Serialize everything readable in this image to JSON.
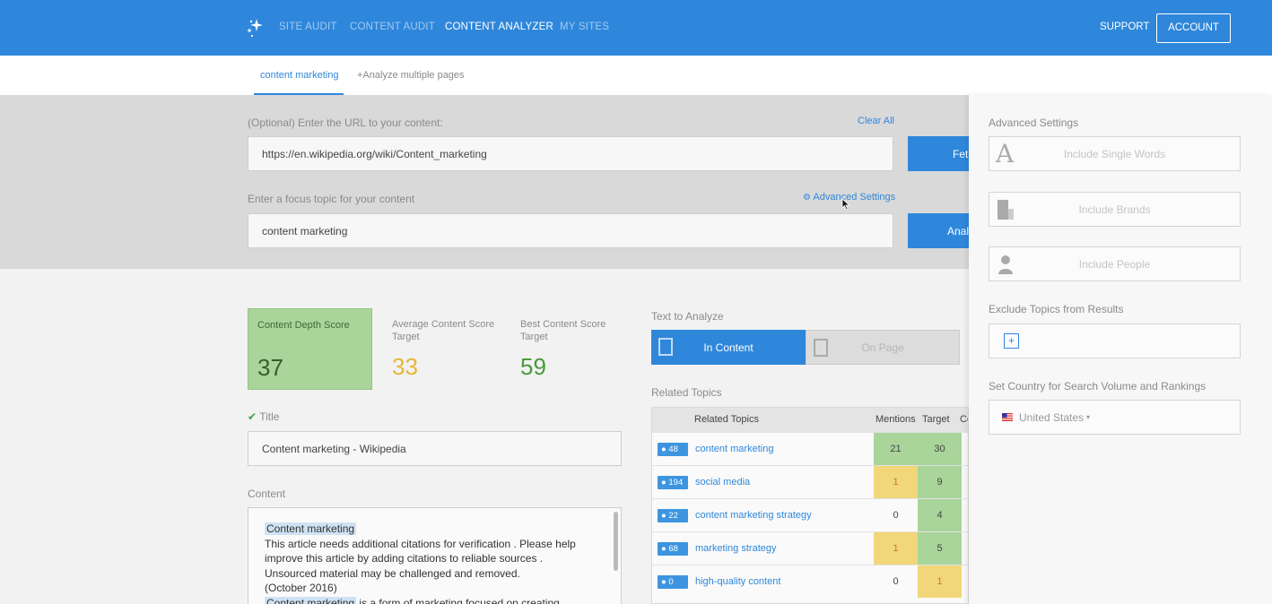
{
  "nav": {
    "items": [
      "SITE AUDIT",
      "CONTENT AUDIT",
      "CONTENT ANALYZER",
      "MY SITES"
    ],
    "active": "CONTENT ANALYZER",
    "support": "SUPPORT",
    "account": "ACCOUNT"
  },
  "subtabs": {
    "current": "content marketing",
    "add": "+Analyze multiple pages"
  },
  "inputs": {
    "url_label": "(Optional) Enter the URL to your content:",
    "clear_all": "Clear All",
    "url_value": "https://en.wikipedia.org/wiki/Content_marketing",
    "fetch_button": "Fetch",
    "focus_label": "Enter a focus topic for your content",
    "advanced_link": "Advanced Settings",
    "focus_value": "content marketing",
    "analyze_button": "Analyze"
  },
  "scores": {
    "depth_label": "Content Depth Score",
    "depth_value": "37",
    "avg_label": "Average Content Score Target",
    "avg_value": "33",
    "best_label": "Best Content Score Target",
    "best_value": "59"
  },
  "title_section": {
    "label": "Title",
    "value": "Content marketing - Wikipedia"
  },
  "content_section": {
    "label": "Content",
    "lines": [
      "Content marketing",
      "This article needs additional citations for verification . Please help",
      "improve this article by adding citations to reliable sources .",
      "Unsourced material may be challenged and removed.",
      "(October 2016)",
      "Content marketing",
      " is a form of marketing focused on creating,"
    ]
  },
  "analyze_toggle": {
    "label": "Text to Analyze",
    "in_content": "In Content",
    "on_page": "On Page"
  },
  "related": {
    "label": "Related Topics",
    "headers": [
      "Related Topics",
      "Mentions",
      "Target",
      "Co"
    ],
    "rows": [
      {
        "badge": "48",
        "topic": "content marketing",
        "mentions": "21",
        "target": "30",
        "m_color": "green",
        "t_color": "green"
      },
      {
        "badge": "194",
        "topic": "social media",
        "mentions": "1",
        "target": "9",
        "m_color": "yellow",
        "t_color": "green"
      },
      {
        "badge": "22",
        "topic": "content marketing strategy",
        "mentions": "0",
        "target": "4",
        "m_color": "none",
        "t_color": "green"
      },
      {
        "badge": "68",
        "topic": "marketing strategy",
        "mentions": "1",
        "target": "5",
        "m_color": "yellow",
        "t_color": "green"
      },
      {
        "badge": "0",
        "topic": "high-quality content",
        "mentions": "0",
        "target": "1",
        "m_color": "none",
        "t_color": "yellow"
      }
    ]
  },
  "advanced": {
    "title": "Advanced Settings",
    "single_words": "Include Single Words",
    "brands": "Include Brands",
    "people": "Include People",
    "exclude_label": "Exclude Topics from Results",
    "exclude_add": "+",
    "country_label": "Set Country for Search Volume and Rankings",
    "country_value": "United States"
  },
  "colors": {
    "brand_blue": "#2f87db",
    "score_green": "#a9d49a",
    "score_yellow": "#e8b43a",
    "score_green_text": "#4a9a3a"
  }
}
